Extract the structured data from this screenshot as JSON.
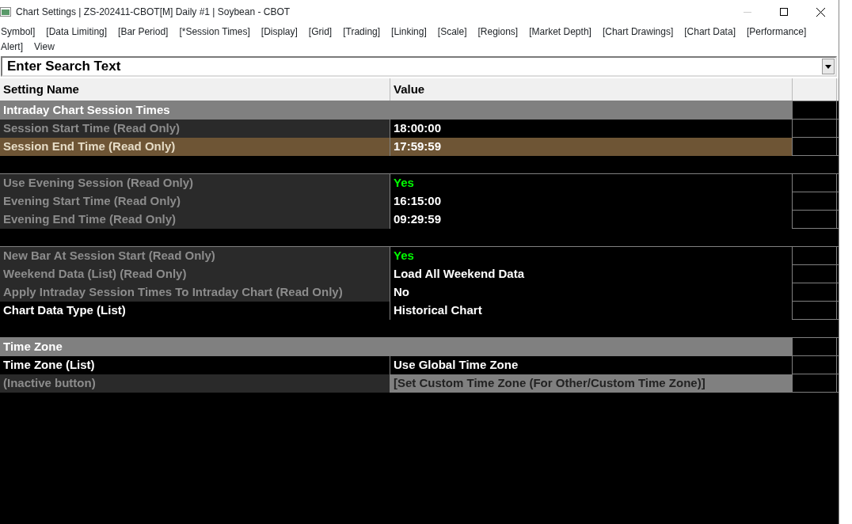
{
  "window": {
    "title": "Chart Settings | ZS-202411-CBOT[M]  Daily #1 | Soybean - CBOT"
  },
  "menu": [
    "Symbol]",
    "[Data Limiting]",
    "[Bar Period]",
    "[*Session Times]",
    "[Display]",
    "[Grid]",
    "[Trading]",
    "[Linking]",
    "[Scale]",
    "[Regions]",
    "[Market Depth]",
    "[Chart Drawings]",
    "[Chart Data]",
    "[Performance]",
    "Alert]",
    "View"
  ],
  "search": {
    "value": "Enter Search Text"
  },
  "table": {
    "columns": [
      "Setting Name",
      "Value"
    ],
    "rows": [
      {
        "kind": "section",
        "name": "Intraday Chart Session Times"
      },
      {
        "kind": "setting",
        "name": "Session Start Time (Read Only)",
        "value": "18:00:00",
        "read_only": true,
        "selected": false
      },
      {
        "kind": "setting",
        "name": "Session End Time (Read Only)",
        "value": "17:59:59",
        "read_only": true,
        "selected": true
      },
      {
        "kind": "blank"
      },
      {
        "kind": "setting",
        "name": "Use Evening Session (Read Only)",
        "value": "Yes",
        "read_only": true,
        "selected": false,
        "color": "#00ff00"
      },
      {
        "kind": "setting",
        "name": "Evening Start Time (Read Only)",
        "value": "16:15:00",
        "read_only": true,
        "selected": false
      },
      {
        "kind": "setting",
        "name": "Evening End Time (Read Only)",
        "value": "09:29:59",
        "read_only": true,
        "selected": false
      },
      {
        "kind": "blank"
      },
      {
        "kind": "setting",
        "name": "New Bar At Session Start (Read Only)",
        "value": "Yes",
        "read_only": true,
        "selected": false,
        "color": "#00ff00"
      },
      {
        "kind": "setting",
        "name": "Weekend Data (List) (Read Only)",
        "value": "Load All Weekend Data",
        "read_only": true,
        "selected": false
      },
      {
        "kind": "setting",
        "name": "Apply Intraday Session Times To Intraday Chart (Read Only)",
        "value": "No",
        "read_only": true,
        "selected": false
      },
      {
        "kind": "setting",
        "name": "Chart Data Type (List)",
        "value": "Historical Chart",
        "read_only": false,
        "selected": false
      },
      {
        "kind": "blank"
      },
      {
        "kind": "section",
        "name": "Time Zone"
      },
      {
        "kind": "setting",
        "name": "Time Zone (List)",
        "value": "Use Global Time Zone",
        "read_only": false,
        "selected": false
      },
      {
        "kind": "button",
        "name": " (Inactive button)",
        "value": "[Set Custom Time Zone (For Other/Custom Time Zone)]"
      }
    ]
  }
}
